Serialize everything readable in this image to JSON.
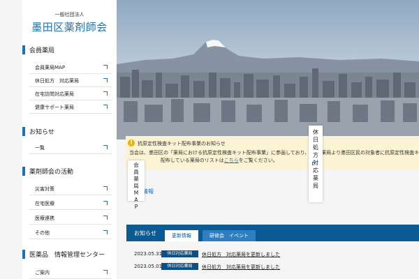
{
  "org": {
    "subtitle": "一般社団法人",
    "name": "墨田区薬剤師会"
  },
  "sidebar": {
    "sections": [
      {
        "heading": "会員薬局",
        "items": [
          "会員薬局MAP",
          "休日処方　対応薬局",
          "在宅訪問対応薬局",
          "健康サポート薬局"
        ]
      },
      {
        "heading": "お知らせ",
        "items": [
          "一覧"
        ]
      },
      {
        "heading": "薬剤師会の活動",
        "items": [
          "災害対策",
          "在宅医療",
          "医療連携",
          "その他"
        ]
      },
      {
        "heading": "医薬品　情報管理センター",
        "items": [
          "ご案内"
        ]
      }
    ]
  },
  "notice": {
    "title": "抗原定性検査キット配布事業のお知らせ",
    "body_line1": "当会は、墨田区の「薬局における抗原定性検査キット配布事業」に参画しており、",
    "body_line1_tail": "員薬局より墨田区民の対象者に抗原定性検査キ",
    "body_line2_pre": "配布している薬局のリストは",
    "body_line2_link": "こちら",
    "body_line2_post": "をご覧ください。"
  },
  "floating_tabs": {
    "member_map": "会員薬局MAP",
    "holiday": "休日処方　対応薬局"
  },
  "pharmacy_info_label": "局情報",
  "news": {
    "label": "お知らせ",
    "tabs": [
      "更新情報",
      "研修会　イベント"
    ],
    "rows": [
      {
        "date": "2023.05.31",
        "badge": "休日対応薬局",
        "title": "休日処方　対応薬局を更新しました"
      },
      {
        "date": "2023.05.01",
        "badge": "休日対応薬局",
        "title": "休日処方　対応薬局を更新しました"
      }
    ]
  },
  "colors": {
    "brand": "#1a73b8",
    "navy": "#0b5a93",
    "notice_bg": "#fbf3d4"
  }
}
